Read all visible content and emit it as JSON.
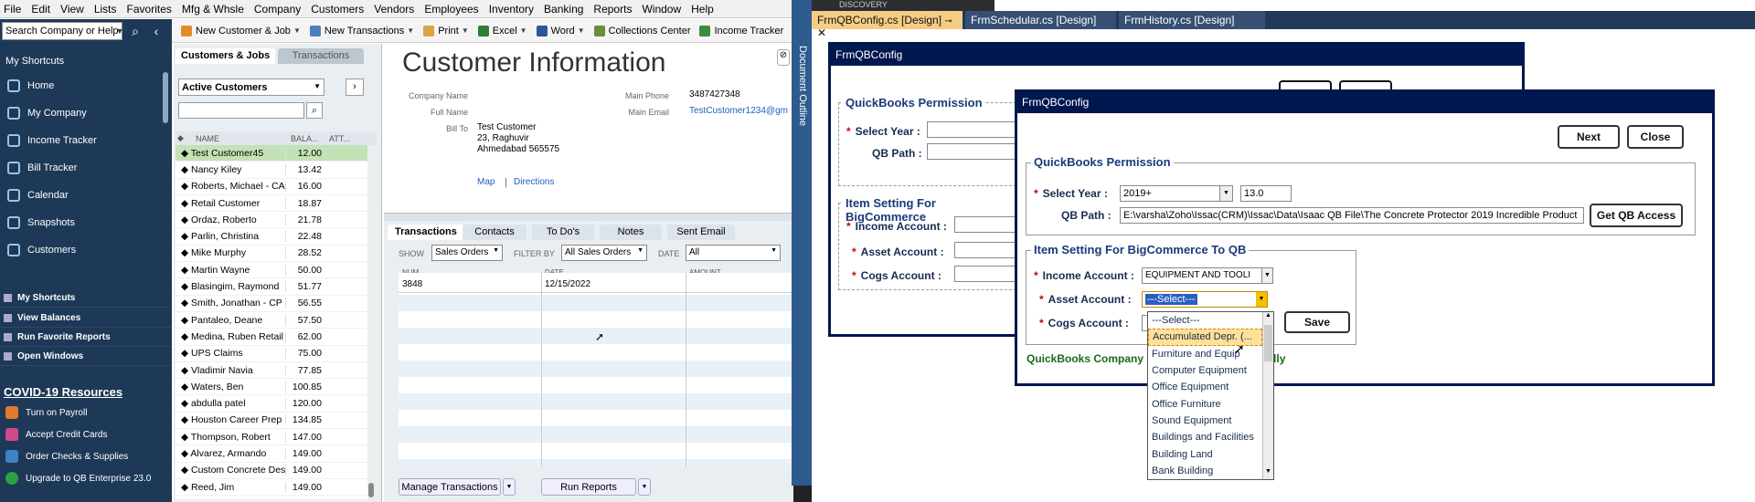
{
  "menubar": [
    "File",
    "Edit",
    "View",
    "Lists",
    "Favorites",
    "Mfg & Whsle",
    "Company",
    "Customers",
    "Vendors",
    "Employees",
    "Inventory",
    "Banking",
    "Reports",
    "Window",
    "Help"
  ],
  "sidebar": {
    "search_placeholder": "Search Company or Help",
    "my_shortcuts_label": "My Shortcuts",
    "items": [
      "Home",
      "My Company",
      "Income Tracker",
      "Bill Tracker",
      "Calendar",
      "Snapshots",
      "Customers"
    ],
    "lower": [
      "My Shortcuts",
      "View Balances",
      "Run Favorite Reports",
      "Open Windows"
    ],
    "covid_title": "COVID-19 Resources",
    "covid_items": [
      "Turn on Payroll",
      "Accept Credit Cards",
      "Order Checks & Supplies",
      "Upgrade to QB Enterprise 23.0"
    ]
  },
  "toolbar": [
    "New Customer & Job",
    "New Transactions",
    "Print",
    "Excel",
    "Word",
    "Collections Center",
    "Income Tracker"
  ],
  "center": {
    "tab_customers": "Customers & Jobs",
    "tab_transactions": "Transactions",
    "filter": "Active Customers",
    "columns": [
      "NAME",
      "BALA...",
      "ATT..."
    ],
    "customers": [
      {
        "name": "Test Customer45",
        "balance": "12.00"
      },
      {
        "name": "Nancy Kiley",
        "balance": "13.42"
      },
      {
        "name": "Roberts, Michael - CA",
        "balance": "16.00"
      },
      {
        "name": "Retail Customer",
        "balance": "18.87"
      },
      {
        "name": "Ordaz, Roberto",
        "balance": "21.78"
      },
      {
        "name": "Parlin, Christina",
        "balance": "22.48"
      },
      {
        "name": "Mike Murphy",
        "balance": "28.52"
      },
      {
        "name": "Martin Wayne",
        "balance": "50.00"
      },
      {
        "name": "Blasingim, Raymond",
        "balance": "51.77"
      },
      {
        "name": "Smith, Jonathan - CP",
        "balance": "56.55"
      },
      {
        "name": "Pantaleo, Deane",
        "balance": "57.50"
      },
      {
        "name": "Medina, Ruben Retail",
        "balance": "62.00"
      },
      {
        "name": "UPS Claims",
        "balance": "75.00"
      },
      {
        "name": "Vladimir Navia",
        "balance": "77.85"
      },
      {
        "name": "Waters, Ben",
        "balance": "100.85"
      },
      {
        "name": "abdulla patel",
        "balance": "120.00"
      },
      {
        "name": "Houston Career Prep",
        "balance": "134.85"
      },
      {
        "name": "Thompson, Robert",
        "balance": "147.00"
      },
      {
        "name": "Alvarez, Armando",
        "balance": "149.00"
      },
      {
        "name": "Custom Concrete Desi...",
        "balance": "149.00"
      },
      {
        "name": "Reed, Jim",
        "balance": "149.00"
      }
    ]
  },
  "info": {
    "title": "Customer Information",
    "company_name_label": "Company Name",
    "full_name_label": "Full Name",
    "bill_to_label": "Bill To",
    "bill_to": [
      "Test Customer",
      "23, Raghuvir",
      "Ahmedabad 565575"
    ],
    "main_phone_label": "Main Phone",
    "main_phone": "3487427348",
    "main_email_label": "Main Email",
    "main_email": "TestCustomer1234@gm",
    "map": "Map",
    "directions": "Directions"
  },
  "trans": {
    "tabs": [
      "Transactions",
      "Contacts",
      "To Do's",
      "Notes",
      "Sent Email"
    ],
    "show_label": "SHOW",
    "show_value": "Sales Orders",
    "filter_label": "FILTER BY",
    "filter_value": "All Sales Orders",
    "date_label": "DATE",
    "date_value": "All",
    "cols": [
      "NUM",
      "DATE",
      "AMOUNT"
    ],
    "row_num": "3848",
    "row_date": "12/15/2022",
    "manage_btn": "Manage Transactions",
    "reports_btn": "Run Reports"
  },
  "vs": {
    "doc_outline": "Document Outline",
    "discovery": "DISCOVERY",
    "tabs": [
      "FrmQBConfig.cs [Design]",
      "FrmSchedular.cs [Design]",
      "FrmHistory.cs [Design]"
    ]
  },
  "form_back": {
    "title": "FrmQBConfig",
    "perm_group": "QuickBooks Permission",
    "select_year": "Select Year :",
    "qb_path": "QB Path :",
    "item_group": "Item Setting For BigCommerce",
    "income": "Income Account :",
    "asset": "Asset Account :",
    "cogs": "Cogs Account :"
  },
  "form_front": {
    "title": "FrmQBConfig",
    "next": "Next",
    "close": "Close",
    "perm_group": "QuickBooks Permission",
    "select_year": "Select Year :",
    "year_value": "2019+",
    "version": "13.0",
    "qb_path": "QB Path :",
    "path_value": "E:\\varsha\\Zoho\\Issac(CRM)\\Issac\\Data\\Isaac QB File\\The Concrete Protector 2019 Incredible Product",
    "get_access": "Get QB Access",
    "item_group": "Item Setting For BigCommerce To QB",
    "income": "Income Account :",
    "income_value": "EQUIPMENT AND TOOLI",
    "asset": "Asset Account :",
    "asset_value": "---Select---",
    "cogs": "Cogs Account :",
    "save": "Save",
    "status_left": "QuickBooks Company",
    "status_right": "cessfully"
  },
  "dropdown": [
    "---Select---",
    "Accumulated  Depr. (...",
    "Furniture and Equip",
    "Computer Equipment",
    "Office Equipment",
    "Office Furniture",
    "Sound Equipment",
    "Buildings and Facilities",
    "Building Land",
    "Bank Building"
  ],
  "colors": {
    "qb_nav": "#1d3957",
    "vs_form_frame": "#00174f",
    "selected_row": "#c3e2b5",
    "dropdown_highlight": "#ffe099"
  }
}
